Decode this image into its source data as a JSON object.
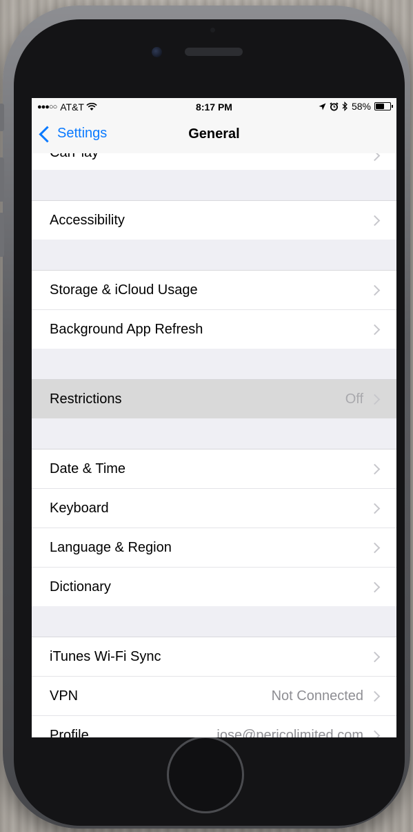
{
  "status_bar": {
    "signal": "●●●○○",
    "carrier": "AT&T",
    "wifi_icon": "wifi-icon",
    "time": "8:17 PM",
    "location_icon": "location-arrow-icon",
    "alarm_icon": "alarm-clock-icon",
    "bluetooth_icon": "bluetooth-icon",
    "battery_percent": "58%",
    "battery_level": 0.58
  },
  "nav": {
    "back_label": "Settings",
    "title": "General"
  },
  "sections": [
    {
      "rows": [
        {
          "label": "CarPlay",
          "value": ""
        }
      ]
    },
    {
      "rows": [
        {
          "label": "Accessibility",
          "value": ""
        }
      ]
    },
    {
      "rows": [
        {
          "label": "Storage & iCloud Usage",
          "value": ""
        },
        {
          "label": "Background App Refresh",
          "value": ""
        }
      ]
    },
    {
      "rows": [
        {
          "label": "Restrictions",
          "value": "Off"
        }
      ]
    },
    {
      "rows": [
        {
          "label": "Date & Time",
          "value": ""
        },
        {
          "label": "Keyboard",
          "value": ""
        },
        {
          "label": "Language & Region",
          "value": ""
        },
        {
          "label": "Dictionary",
          "value": ""
        }
      ]
    },
    {
      "rows": [
        {
          "label": "iTunes Wi-Fi Sync",
          "value": ""
        },
        {
          "label": "VPN",
          "value": "Not Connected"
        },
        {
          "label": "Profile",
          "value": "jose@pericolimited.com"
        }
      ]
    }
  ]
}
